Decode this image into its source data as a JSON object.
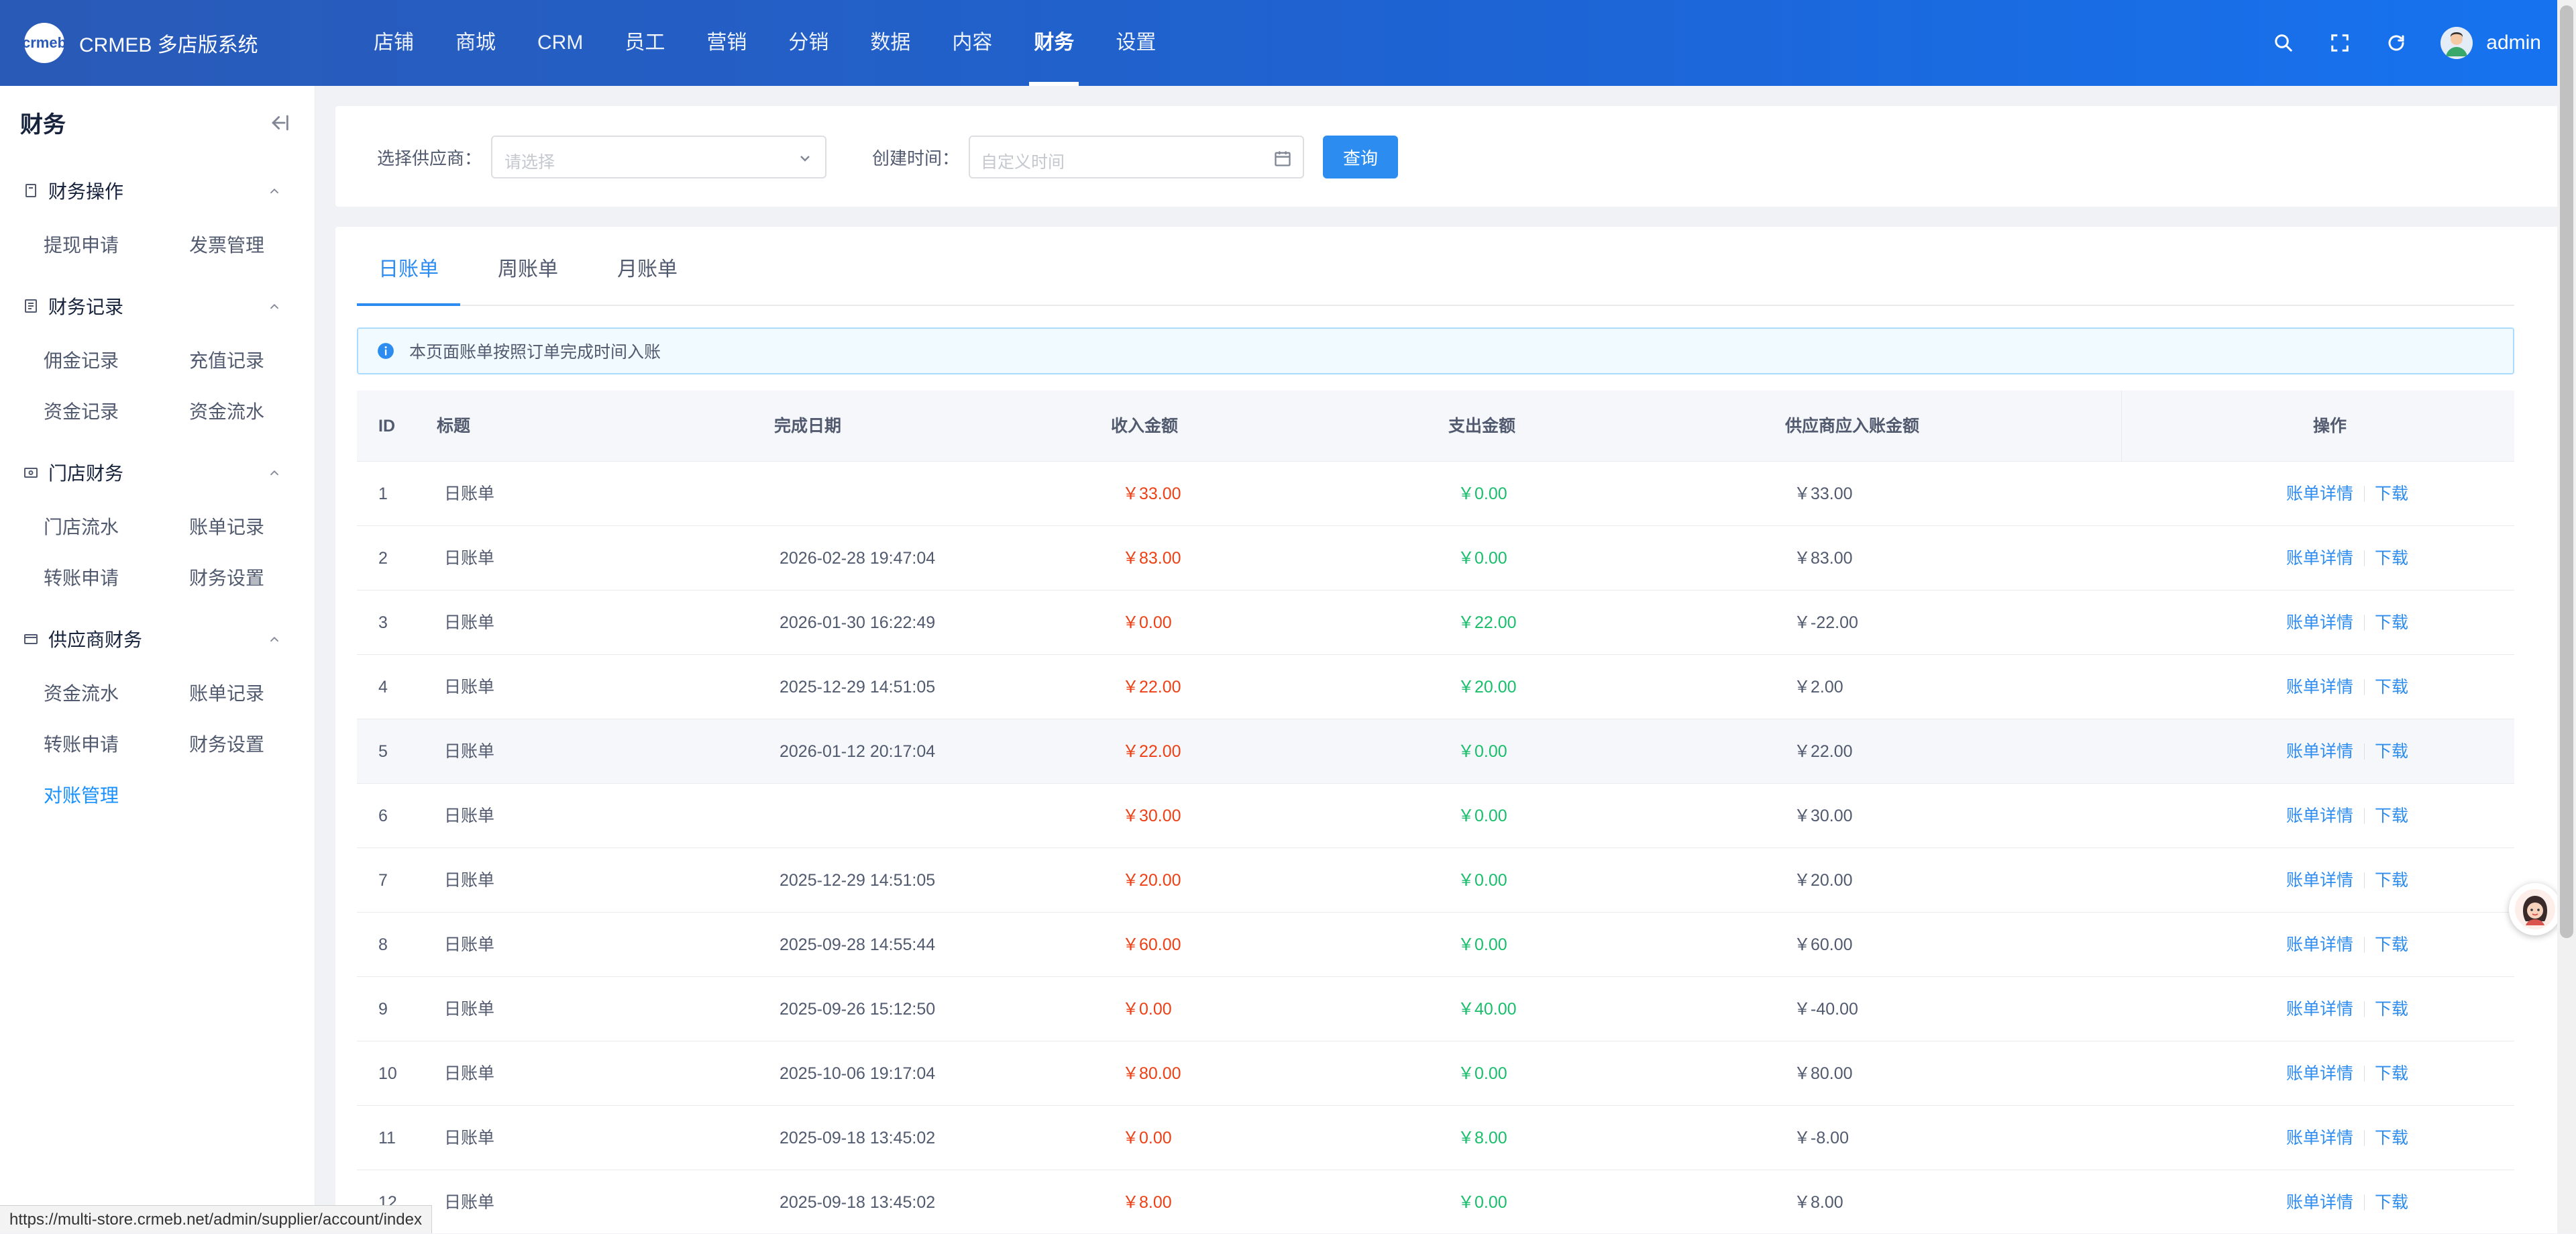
{
  "header": {
    "logo_text": "crmeb",
    "brand": "CRMEB 多店版系统",
    "nav": [
      "店铺",
      "商城",
      "CRM",
      "员工",
      "营销",
      "分销",
      "数据",
      "内容",
      "财务",
      "设置"
    ],
    "active_nav": "财务",
    "user": "admin"
  },
  "sidebar": {
    "title": "财务",
    "groups": [
      {
        "label": "财务操作",
        "items": [
          "提现申请",
          "发票管理"
        ]
      },
      {
        "label": "财务记录",
        "items": [
          "佣金记录",
          "充值记录",
          "资金记录",
          "资金流水"
        ]
      },
      {
        "label": "门店财务",
        "items": [
          "门店流水",
          "账单记录",
          "转账申请",
          "财务设置"
        ]
      },
      {
        "label": "供应商财务",
        "items": [
          "资金流水",
          "账单记录",
          "转账申请",
          "财务设置",
          "对账管理"
        ]
      }
    ],
    "active_item": "对账管理"
  },
  "filter": {
    "supplier_label": "选择供应商：",
    "supplier_placeholder": "请选择",
    "time_label": "创建时间：",
    "time_placeholder": "自定义时间",
    "query_button": "查询"
  },
  "tabs": [
    "日账单",
    "周账单",
    "月账单"
  ],
  "active_tab": "日账单",
  "alert": "本页面账单按照订单完成时间入账",
  "table": {
    "columns": {
      "id": "ID",
      "title": "标题",
      "date": "完成日期",
      "income": "收入金额",
      "expense": "支出金额",
      "supplier": "供应商应入账金额",
      "ops": "操作"
    },
    "op_detail": "账单详情",
    "op_download": "下载",
    "rows": [
      {
        "id": "1",
        "title": "日账单",
        "date": "",
        "income": "￥33.00",
        "expense": "￥0.00",
        "supplier": "￥33.00"
      },
      {
        "id": "2",
        "title": "日账单",
        "date": "2026-02-28 19:47:04",
        "income": "￥83.00",
        "expense": "￥0.00",
        "supplier": "￥83.00"
      },
      {
        "id": "3",
        "title": "日账单",
        "date": "2026-01-30 16:22:49",
        "income": "￥0.00",
        "expense": "￥22.00",
        "supplier": "￥-22.00"
      },
      {
        "id": "4",
        "title": "日账单",
        "date": "2025-12-29 14:51:05",
        "income": "￥22.00",
        "expense": "￥20.00",
        "supplier": "￥2.00"
      },
      {
        "id": "5",
        "title": "日账单",
        "date": "2026-01-12 20:17:04",
        "income": "￥22.00",
        "expense": "￥0.00",
        "supplier": "￥22.00"
      },
      {
        "id": "6",
        "title": "日账单",
        "date": "",
        "income": "￥30.00",
        "expense": "￥0.00",
        "supplier": "￥30.00"
      },
      {
        "id": "7",
        "title": "日账单",
        "date": "2025-12-29 14:51:05",
        "income": "￥20.00",
        "expense": "￥0.00",
        "supplier": "￥20.00"
      },
      {
        "id": "8",
        "title": "日账单",
        "date": "2025-09-28 14:55:44",
        "income": "￥60.00",
        "expense": "￥0.00",
        "supplier": "￥60.00"
      },
      {
        "id": "9",
        "title": "日账单",
        "date": "2025-09-26 15:12:50",
        "income": "￥0.00",
        "expense": "￥40.00",
        "supplier": "￥-40.00"
      },
      {
        "id": "10",
        "title": "日账单",
        "date": "2025-10-06 19:17:04",
        "income": "￥80.00",
        "expense": "￥0.00",
        "supplier": "￥80.00"
      },
      {
        "id": "11",
        "title": "日账单",
        "date": "2025-09-18 13:45:02",
        "income": "￥0.00",
        "expense": "￥8.00",
        "supplier": "￥-8.00"
      },
      {
        "id": "12",
        "title": "日账单",
        "date": "2025-09-18 13:45:02",
        "income": "￥8.00",
        "expense": "￥0.00",
        "supplier": "￥8.00"
      }
    ],
    "hover_row": 5
  },
  "status_url": "https://multi-store.crmeb.net/admin/supplier/account/index",
  "colors": {
    "accent": "#2d8cf0",
    "income": "#ed4014",
    "expense": "#19be6b",
    "header": "#1e63d2"
  }
}
